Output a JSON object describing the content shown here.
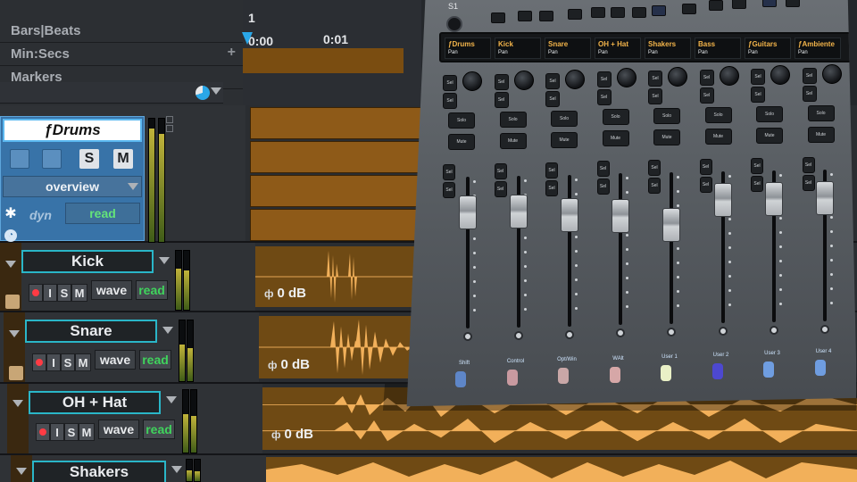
{
  "rulers": {
    "bars_beats": "Bars|Beats",
    "min_secs": "Min:Secs",
    "markers": "Markers",
    "add": "+"
  },
  "timeline": {
    "bar_number": "1",
    "time_start": "0:00",
    "time_next": "0:01"
  },
  "folder_track": {
    "name": "ƒDrums",
    "solo": "S",
    "mute": "M",
    "view": "overview",
    "dyn": "dyn",
    "automation": "read"
  },
  "tracks": [
    {
      "name": "Kick",
      "wave": "wave",
      "auto": "read",
      "i": "I",
      "s": "S",
      "m": "M",
      "gain": "0 dB"
    },
    {
      "name": "Snare",
      "wave": "wave",
      "auto": "read",
      "i": "I",
      "s": "S",
      "m": "M",
      "gain": "0 dB"
    },
    {
      "name": "OH + Hat",
      "wave": "wave",
      "auto": "read",
      "i": "I",
      "s": "S",
      "m": "M",
      "gain": "0 dB"
    },
    {
      "name": "Shakers"
    }
  ],
  "controller": {
    "label": "S1",
    "lcd_channels": [
      {
        "name": "ƒDrums",
        "sub": "Pan"
      },
      {
        "name": "Kick",
        "sub": "Pan"
      },
      {
        "name": "Snare",
        "sub": "Pan"
      },
      {
        "name": "OH + Hat",
        "sub": "Pan"
      },
      {
        "name": "Shakers",
        "sub": "Pan"
      },
      {
        "name": "Bass",
        "sub": "Pan"
      },
      {
        "name": "ƒGuitars",
        "sub": "Pan"
      },
      {
        "name": "ƒAmbiente",
        "sub": "Pan"
      }
    ],
    "strip_keys": {
      "sel": "Sel",
      "solo": "Solo",
      "mute": "Mute"
    },
    "modifiers": [
      {
        "label": "Shift",
        "color": "#5e86c8"
      },
      {
        "label": "Control",
        "color": "#c99aa0"
      },
      {
        "label": "Opt/Win",
        "color": "#c9a7a7"
      },
      {
        "label": "WAlt",
        "color": "#d6a7a7"
      },
      {
        "label": "User 1",
        "color": "#e9f0c6"
      },
      {
        "label": "User 2",
        "color": "#4d48d0"
      },
      {
        "label": "User 3",
        "color": "#6f9de0"
      },
      {
        "label": "User 4",
        "color": "#6f9de0"
      }
    ],
    "faders_level": [
      0.84,
      0.84,
      0.8,
      0.78,
      0.7,
      0.9,
      0.9,
      0.9
    ]
  },
  "colors": {
    "accent_cyan": "#2ab6c8",
    "folder_blue": "#3873a8",
    "waveform": "#f2b05a",
    "read_green": "#3fd35c",
    "record_red": "#ff3b44"
  }
}
